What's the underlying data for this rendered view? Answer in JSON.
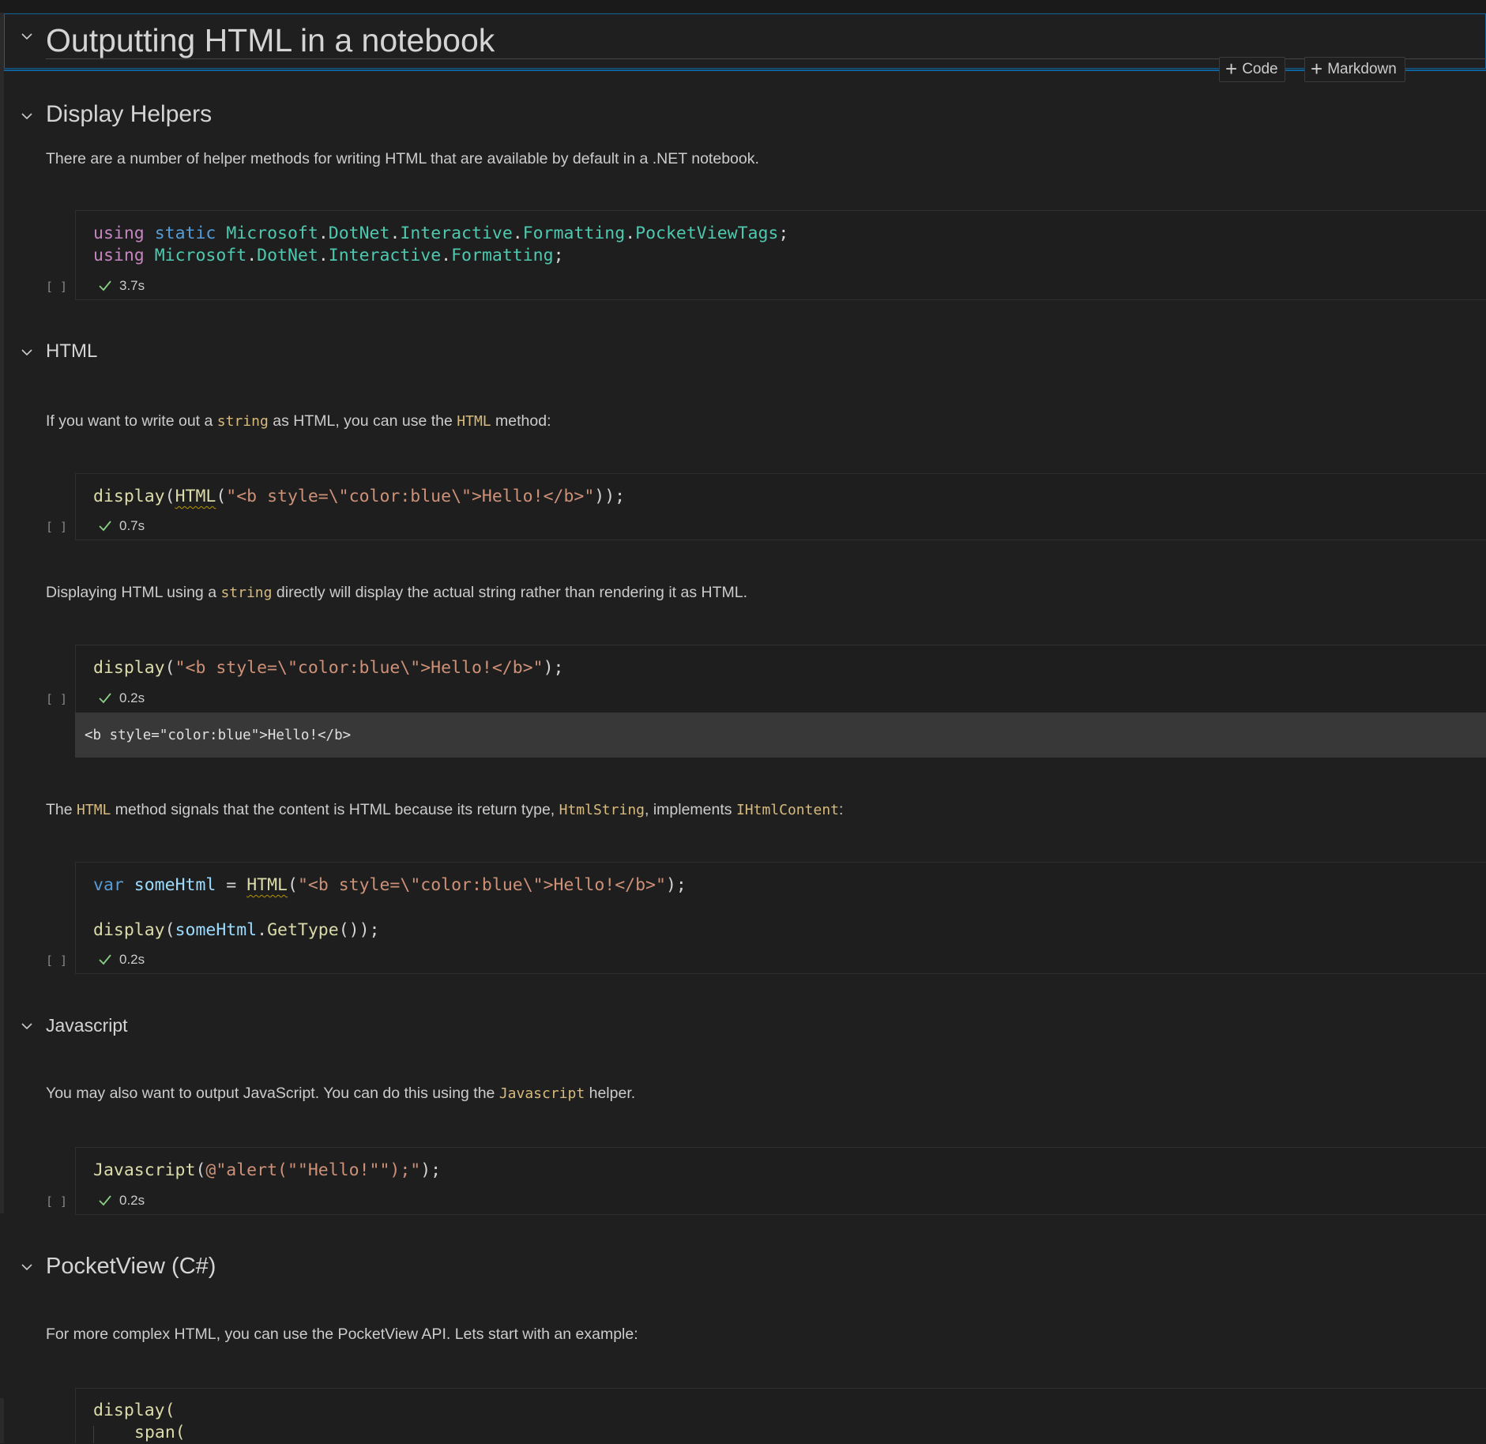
{
  "notebook": {
    "title": "Outputting HTML in a notebook",
    "insert_code_label": "Code",
    "insert_markdown_label": "Markdown"
  },
  "sections": {
    "display_helpers": {
      "heading": "Display Helpers",
      "para": "There are a number of helper methods for writing HTML that are available by default in a .NET notebook.",
      "cell1": {
        "line1": {
          "k1": "using",
          "k2": "static",
          "t1": "Microsoft",
          "t2": "DotNet",
          "t3": "Interactive",
          "t4": "Formatting",
          "t5": "PocketViewTags",
          "end": ";"
        },
        "line2": {
          "k1": "using",
          "t1": "Microsoft",
          "t2": "DotNet",
          "t3": "Interactive",
          "t4": "Formatting",
          "end": ";"
        },
        "exec_bracket": "[ ]",
        "time": "3.7s"
      }
    },
    "html": {
      "heading": "HTML",
      "para1": {
        "a": "If you want to write out a ",
        "code1": "string",
        "b": " as HTML, you can use the ",
        "code2": "HTML",
        "c": " method:"
      },
      "cell2": {
        "fn": "display",
        "open": "(",
        "fn2": "HTML",
        "open2": "(",
        "str": "\"<b style=\\\"color:blue\\\">Hello!</b>\"",
        "close": "));",
        "exec_bracket": "[ ]",
        "time": "0.7s"
      },
      "para2": {
        "a": "Displaying HTML using a ",
        "code1": "string",
        "b": " directly will display the actual string rather than rendering it as HTML."
      },
      "cell3": {
        "fn": "display",
        "open": "(",
        "str": "\"<b style=\\\"color:blue\\\">Hello!</b>\"",
        "close": ");",
        "exec_bracket": "[ ]",
        "time": "0.2s",
        "output": "<b style=\"color:blue\">Hello!</b>"
      },
      "para3": {
        "a": "The ",
        "code1": "HTML",
        "b": " method signals that the content is HTML because its return type, ",
        "code2": "HtmlString",
        "c": ", implements ",
        "code3": "IHtmlContent",
        "d": ":"
      },
      "cell4": {
        "line1": {
          "kw": "var",
          "var": "someHtml",
          "eq": " = ",
          "fn": "HTML",
          "open": "(",
          "str": "\"<b style=\\\"color:blue\\\">Hello!</b>\"",
          "close": ");"
        },
        "line2": {
          "fn": "display",
          "open": "(",
          "var": "someHtml",
          "dot": ".",
          "fn2": "GetType",
          "close": "());"
        },
        "exec_bracket": "[ ]",
        "time": "0.2s"
      }
    },
    "javascript": {
      "heading": "Javascript",
      "para": {
        "a": "You may also want to output JavaScript. You can do this using the ",
        "code1": "Javascript",
        "b": " helper."
      },
      "cell5": {
        "fn": "Javascript",
        "open": "(",
        "str": "@\"alert(\"\"Hello!\"\");\"",
        "close": ");",
        "exec_bracket": "[ ]",
        "time": "0.2s"
      }
    },
    "pocketview": {
      "heading": "PocketView (C#)",
      "para": "For more complex HTML, you can use the PocketView API. Lets start with an example:",
      "cell6": {
        "line1": "display(",
        "line2": "span("
      }
    }
  }
}
